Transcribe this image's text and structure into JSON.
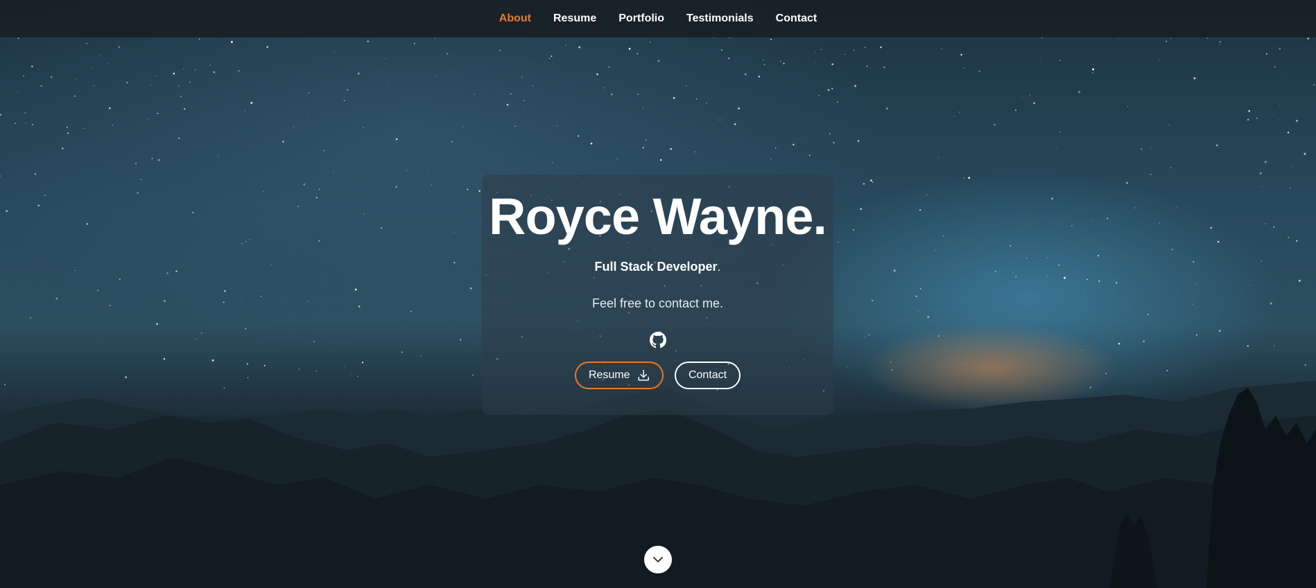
{
  "nav": {
    "items": [
      {
        "label": "About",
        "active": true
      },
      {
        "label": "Resume",
        "active": false
      },
      {
        "label": "Portfolio",
        "active": false
      },
      {
        "label": "Testimonials",
        "active": false
      },
      {
        "label": "Contact",
        "active": false
      }
    ]
  },
  "hero": {
    "name": "Royce Wayne.",
    "role": "Full Stack Developer",
    "role_suffix": ".",
    "tagline": "Feel free to contact me.",
    "social_icon": "github-icon",
    "buttons": {
      "resume_label": "Resume",
      "resume_icon": "download-icon",
      "contact_label": "Contact"
    },
    "scroll_icon": "chevron-down-icon"
  },
  "colors": {
    "accent": "#e87a2a",
    "nav_background": "#172128",
    "text": "#ffffff"
  }
}
